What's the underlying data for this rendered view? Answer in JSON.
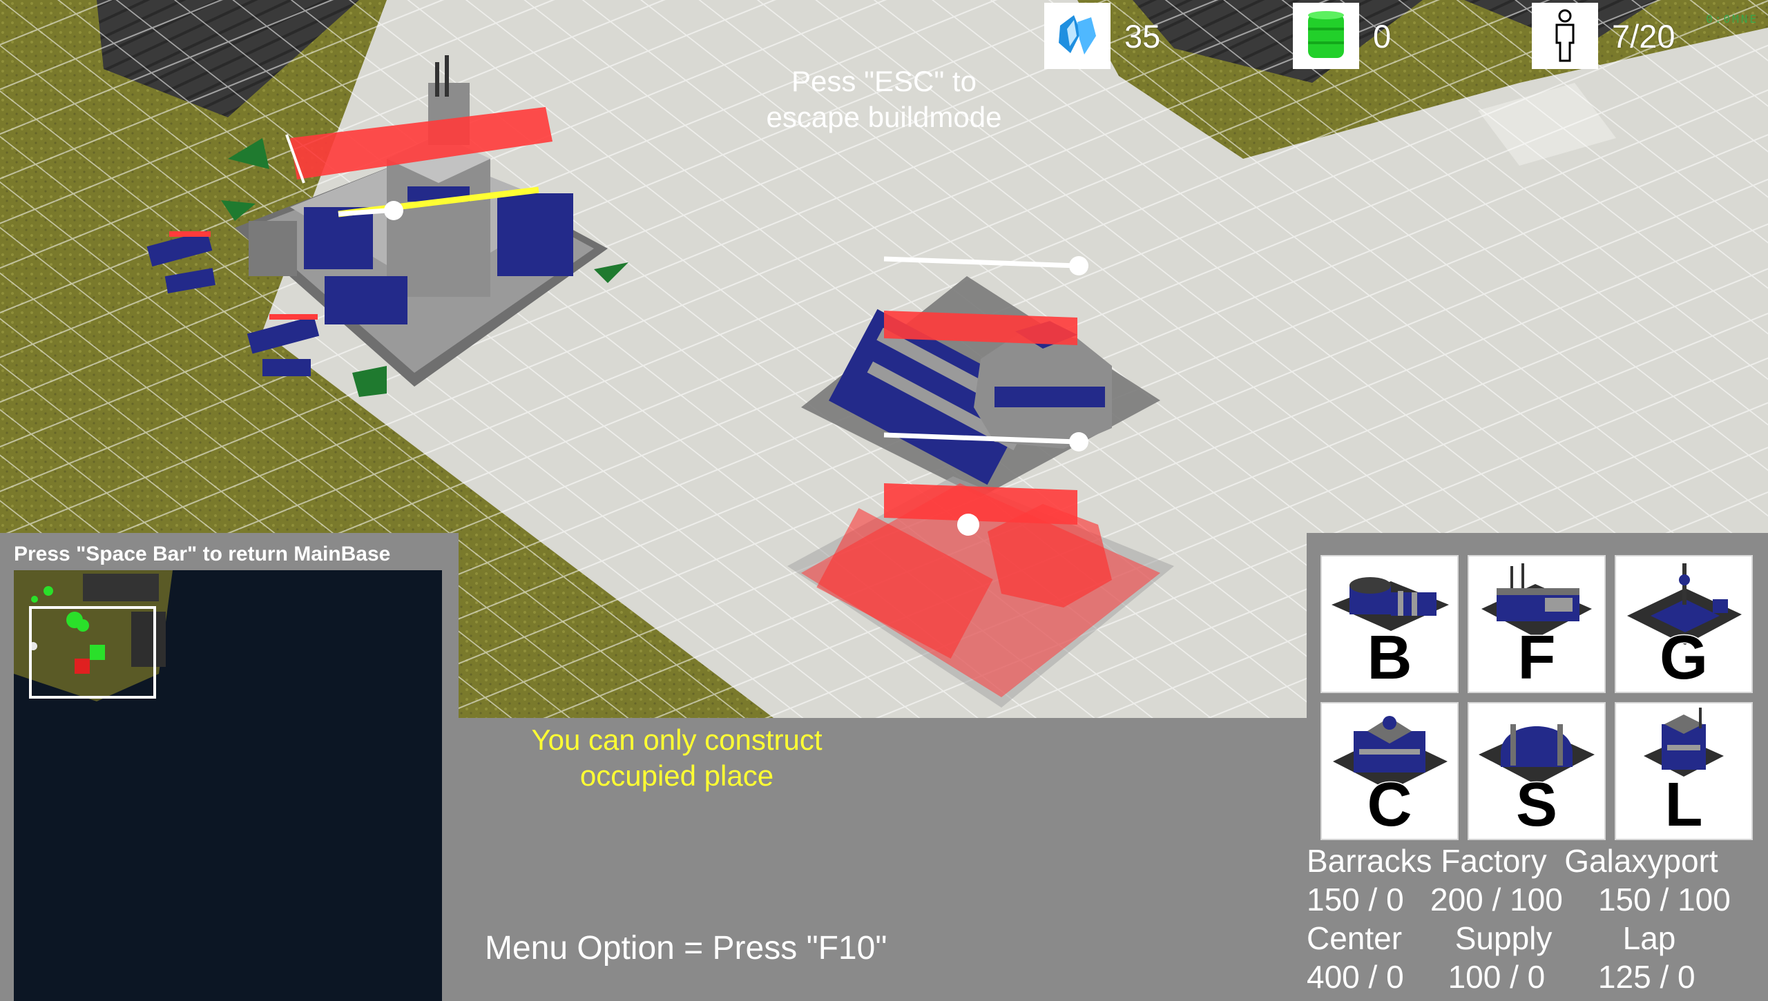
{
  "hud": {
    "crystal": {
      "icon": "crystal-icon",
      "value": "35"
    },
    "gas": {
      "icon": "gas-barrel-icon",
      "value": "0"
    },
    "population": {
      "icon": "population-icon",
      "value": "7/20"
    },
    "fps": "0:0MNE"
  },
  "messages": {
    "esc_hint": "Pess \"ESC\" to\nescape buildmode",
    "construct_warning": "You can only construct\noccupied place",
    "menu_hint": "Menu Option = Press \"F10\""
  },
  "minimap": {
    "title": "Press \"Space Bar\" to return MainBase"
  },
  "build_menu": {
    "buttons": [
      {
        "key": "B",
        "icon": "barracks-icon"
      },
      {
        "key": "F",
        "icon": "factory-icon"
      },
      {
        "key": "G",
        "icon": "galaxyport-icon"
      },
      {
        "key": "C",
        "icon": "center-icon"
      },
      {
        "key": "S",
        "icon": "supply-icon"
      },
      {
        "key": "L",
        "icon": "lap-icon"
      }
    ],
    "cost_lines": [
      "Barracks Factory  Galaxyport",
      "150 / 0   200 / 100    150 / 100",
      "Center      Supply        Lap",
      "400 / 0     100 / 0      125 / 0"
    ]
  },
  "colors": {
    "team": "#232a8a",
    "invalid_placement": "#ff3b3b",
    "warning": "#ffff33",
    "ground": "#d9d9d3",
    "grass": "#7f7f2e"
  }
}
